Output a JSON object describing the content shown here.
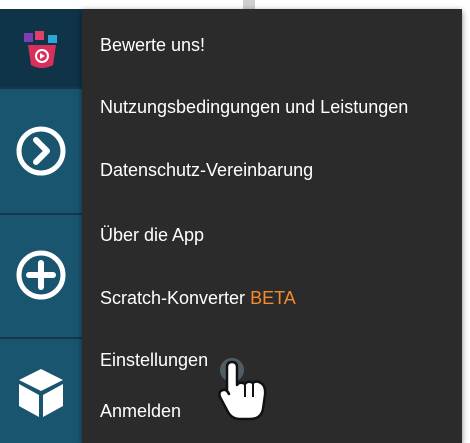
{
  "menu": {
    "items": [
      {
        "label": "Bewerte uns!"
      },
      {
        "label": "Nutzungsbedingungen und Leistungen"
      },
      {
        "label": "Datenschutz-Vereinbarung"
      },
      {
        "label": "Über die App"
      },
      {
        "label": "Scratch-Konverter",
        "badge": "BETA"
      },
      {
        "label": "Einstellungen"
      },
      {
        "label": "Anmelden"
      }
    ]
  },
  "sidebar": {
    "icons": [
      "app-logo-icon",
      "play-icon",
      "add-icon",
      "cube-icon"
    ]
  },
  "colors": {
    "menu_background": "#2b2b2b",
    "sidebar_tile": "#1a5570",
    "beta_accent": "#f58a2a"
  }
}
